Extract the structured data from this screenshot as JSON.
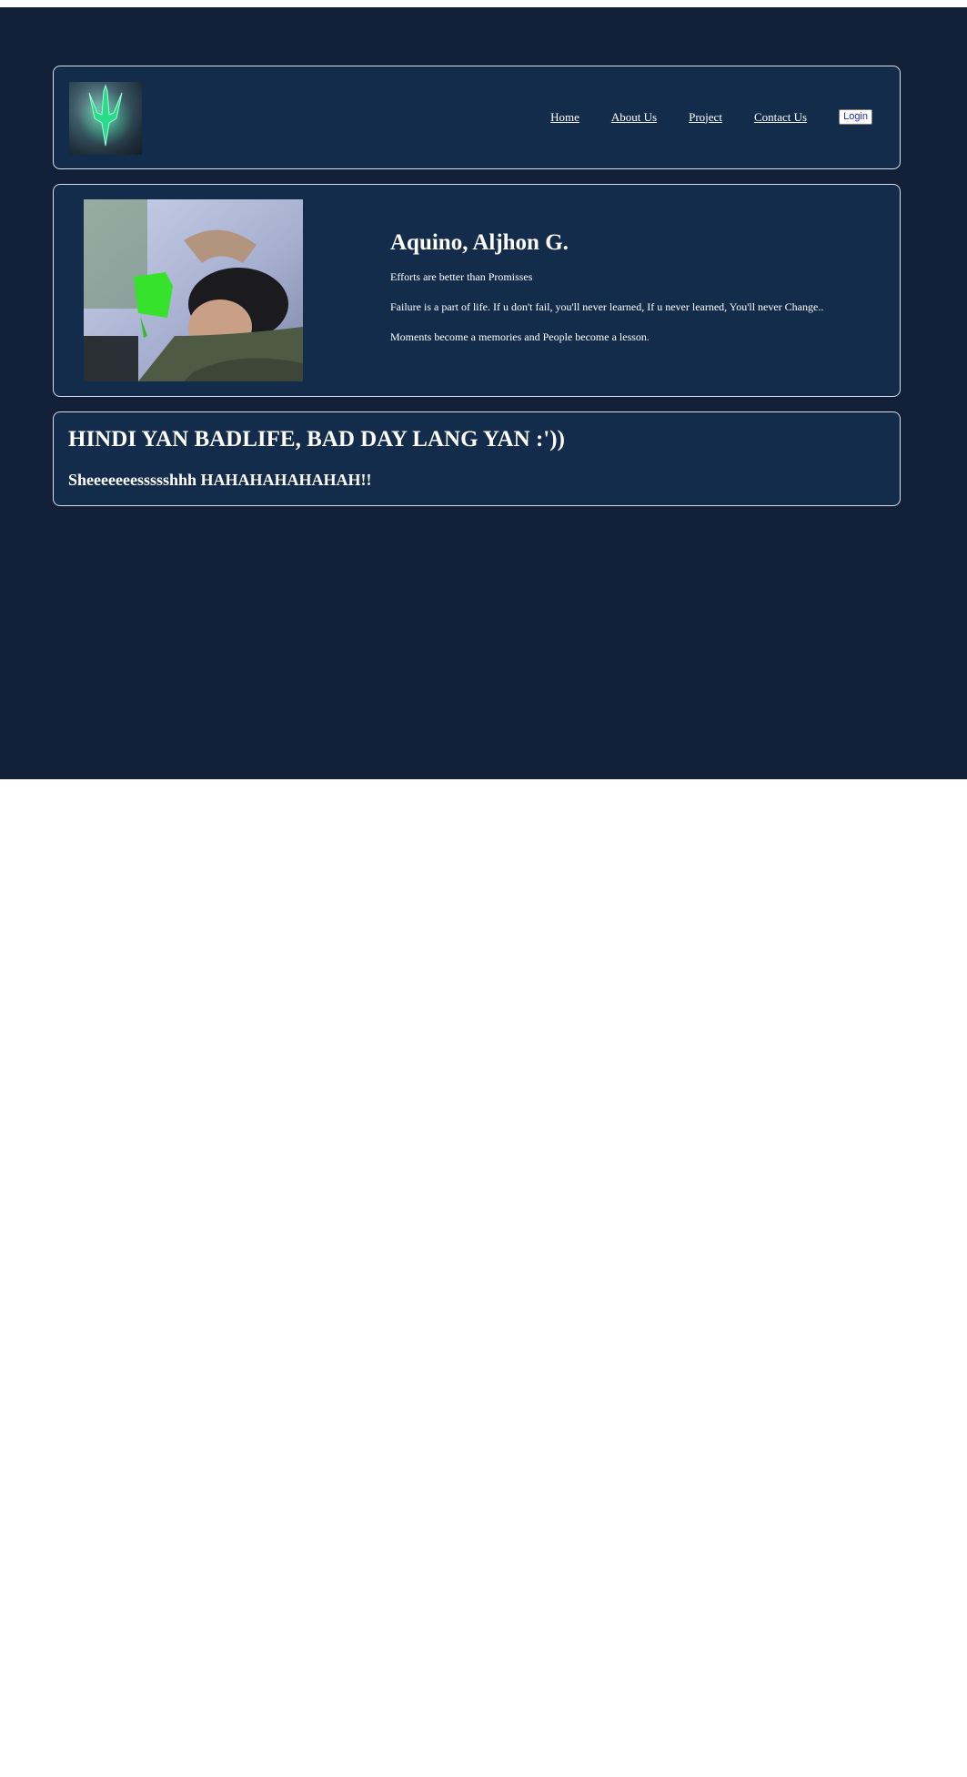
{
  "nav": {
    "logo_icon": "trident-logo-icon",
    "items": [
      {
        "label": "Home"
      },
      {
        "label": "About Us"
      },
      {
        "label": "Project"
      },
      {
        "label": "Contact Us"
      }
    ],
    "login_label": "Login"
  },
  "profile": {
    "photo": "profile-photo",
    "name": "Aquino, Aljhon G.",
    "lines": [
      "Efforts are better than Promisses",
      "Failure is a part of life. If u don't fail, you'll never learned, If u never learned, You'll never Change..",
      "Moments become a memories and People become a lesson."
    ]
  },
  "quote": {
    "title": "HINDI YAN BADLIFE, BAD DAY LANG YAN :'))",
    "subtitle": "Sheeeeeeessssshhh HAHAHAHAHAHAH!!"
  },
  "colors": {
    "page_background": "#112036",
    "card_background": "#142c4c",
    "card_border": "#d9dee7",
    "text": "#ffffff",
    "login_text": "#1f2bd6",
    "logo_accent": "#2bd98a"
  }
}
